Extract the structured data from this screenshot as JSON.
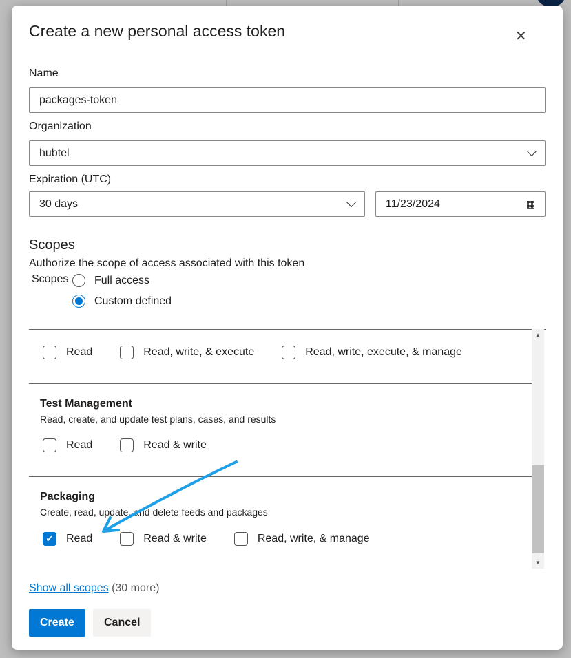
{
  "dialog": {
    "title": "Create a new personal access token",
    "close_icon": "close-icon"
  },
  "name": {
    "label": "Name",
    "value": "packages-token"
  },
  "organization": {
    "label": "Organization",
    "value": "hubtel"
  },
  "expiration": {
    "label": "Expiration (UTC)",
    "value": "30 days",
    "date": "11/23/2024"
  },
  "scopes": {
    "heading": "Scopes",
    "description": "Authorize the scope of access associated with this token",
    "label": "Scopes",
    "options": [
      {
        "label": "Full access",
        "selected": false
      },
      {
        "label": "Custom defined",
        "selected": true
      }
    ]
  },
  "sections": [
    {
      "title": "",
      "description": "",
      "options": [
        {
          "label": "Read",
          "checked": false
        },
        {
          "label": "Read, write, & execute",
          "checked": false
        },
        {
          "label": "Read, write, execute, & manage",
          "checked": false
        }
      ]
    },
    {
      "title": "Test Management",
      "description": "Read, create, and update test plans, cases, and results",
      "options": [
        {
          "label": "Read",
          "checked": false
        },
        {
          "label": "Read & write",
          "checked": false
        }
      ]
    },
    {
      "title": "Packaging",
      "description": "Create, read, update, and delete feeds and packages",
      "options": [
        {
          "label": "Read",
          "checked": true
        },
        {
          "label": "Read & write",
          "checked": false
        },
        {
          "label": "Read, write, & manage",
          "checked": false
        }
      ]
    }
  ],
  "show_all": {
    "link": "Show all scopes",
    "count": "(30 more)"
  },
  "buttons": {
    "create": "Create",
    "cancel": "Cancel"
  },
  "colors": {
    "primary": "#0078d4",
    "annotation_arrow": "#1ea0e6"
  }
}
